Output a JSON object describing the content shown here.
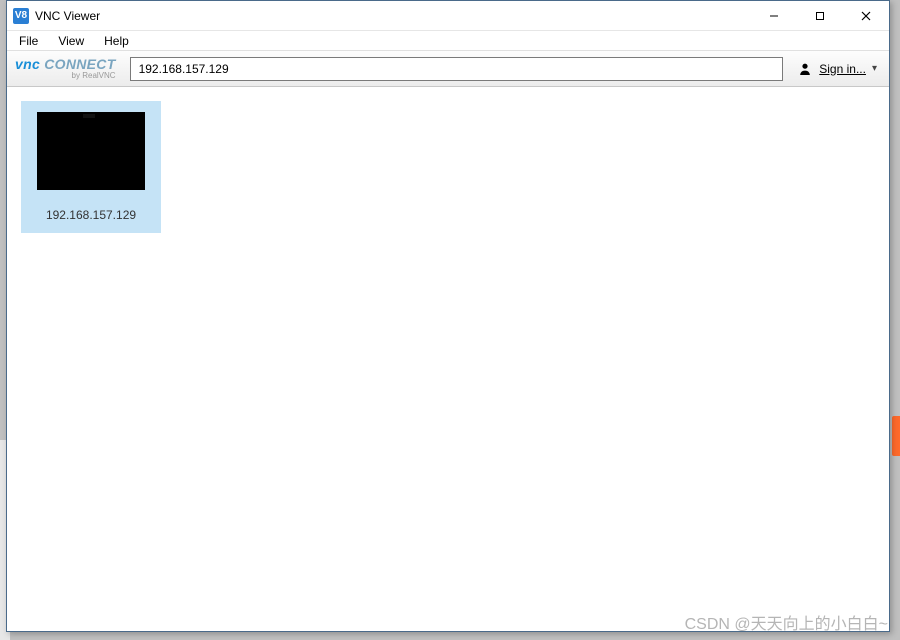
{
  "window": {
    "title": "VNC Viewer",
    "icon_text": "V8"
  },
  "menu": {
    "file": "File",
    "view": "View",
    "help": "Help"
  },
  "toolbar": {
    "logo_vnc": "vnc",
    "logo_connect": "CONNECT",
    "logo_sub": "by RealVNC",
    "address_value": "192.168.157.129",
    "signin_label": "Sign in..."
  },
  "connections": [
    {
      "label": "192.168.157.129"
    }
  ],
  "watermark": "CSDN @天天向上的小白白~"
}
